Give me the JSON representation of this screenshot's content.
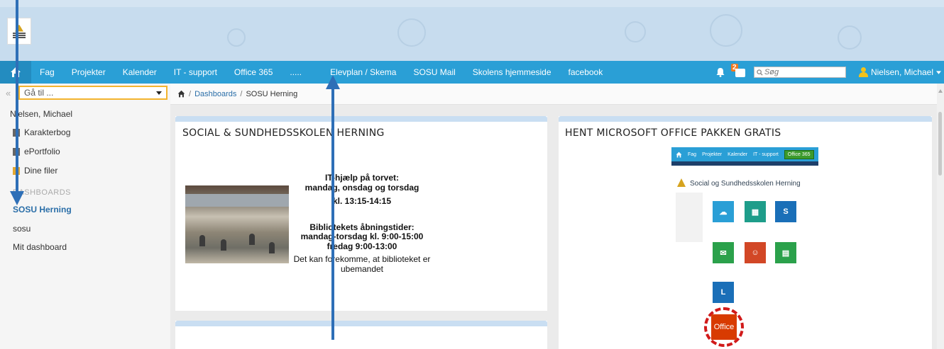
{
  "navbar": {
    "items": [
      "Fag",
      "Projekter",
      "Kalender",
      "IT - support",
      "Office 365",
      ".....",
      "Elevplan / Skema",
      "SOSU Mail",
      "Skolens hjemmeside",
      "facebook"
    ],
    "notification_count": "2",
    "search_placeholder": "Søg",
    "user_name": "Nielsen, Michael"
  },
  "sidebar": {
    "goto_label": "Gå til ...",
    "user": "Nielsen, Michael",
    "items": [
      "Karakterbog",
      "ePortfolio",
      "Dine filer"
    ],
    "dashboards_heading": "DASHBOARDS",
    "dashboards": [
      "SOSU Herning",
      "sosu",
      "Mit dashboard"
    ]
  },
  "breadcrumb": {
    "link": "Dashboards",
    "current": "SOSU Herning"
  },
  "panel_left": {
    "title": "SOCIAL & SUNDHEDSSKOLEN HERNING",
    "help_heading": "IT-hjælp på torvet:",
    "help_days": "mandag, onsdag og torsdag",
    "help_time": "kl. 13:15-14:15",
    "library_heading": "Bibliotekets åbningstider:",
    "library_weekdays": "mandag-torsdag kl. 9:00-15:00",
    "library_friday": "fredag 9:00-13:00",
    "library_note_1": "Det kan forekomme, at biblioteket er",
    "library_note_2": "ubemandet"
  },
  "panel_right": {
    "title": "HENT MICROSOFT OFFICE PAKKEN GRATIS",
    "screenshot": {
      "nav": [
        "Fag",
        "Projekter",
        "Kalender",
        "IT - support",
        "Office 365"
      ],
      "title": "Social og Sundhedsskolen Herning",
      "office_label": "Office"
    }
  },
  "colors": {
    "navbar": "#2a9fd6",
    "accent_link": "#2a6ea8",
    "goto_border": "#f3b42e",
    "annotation_arrow": "#2e6fb7"
  }
}
